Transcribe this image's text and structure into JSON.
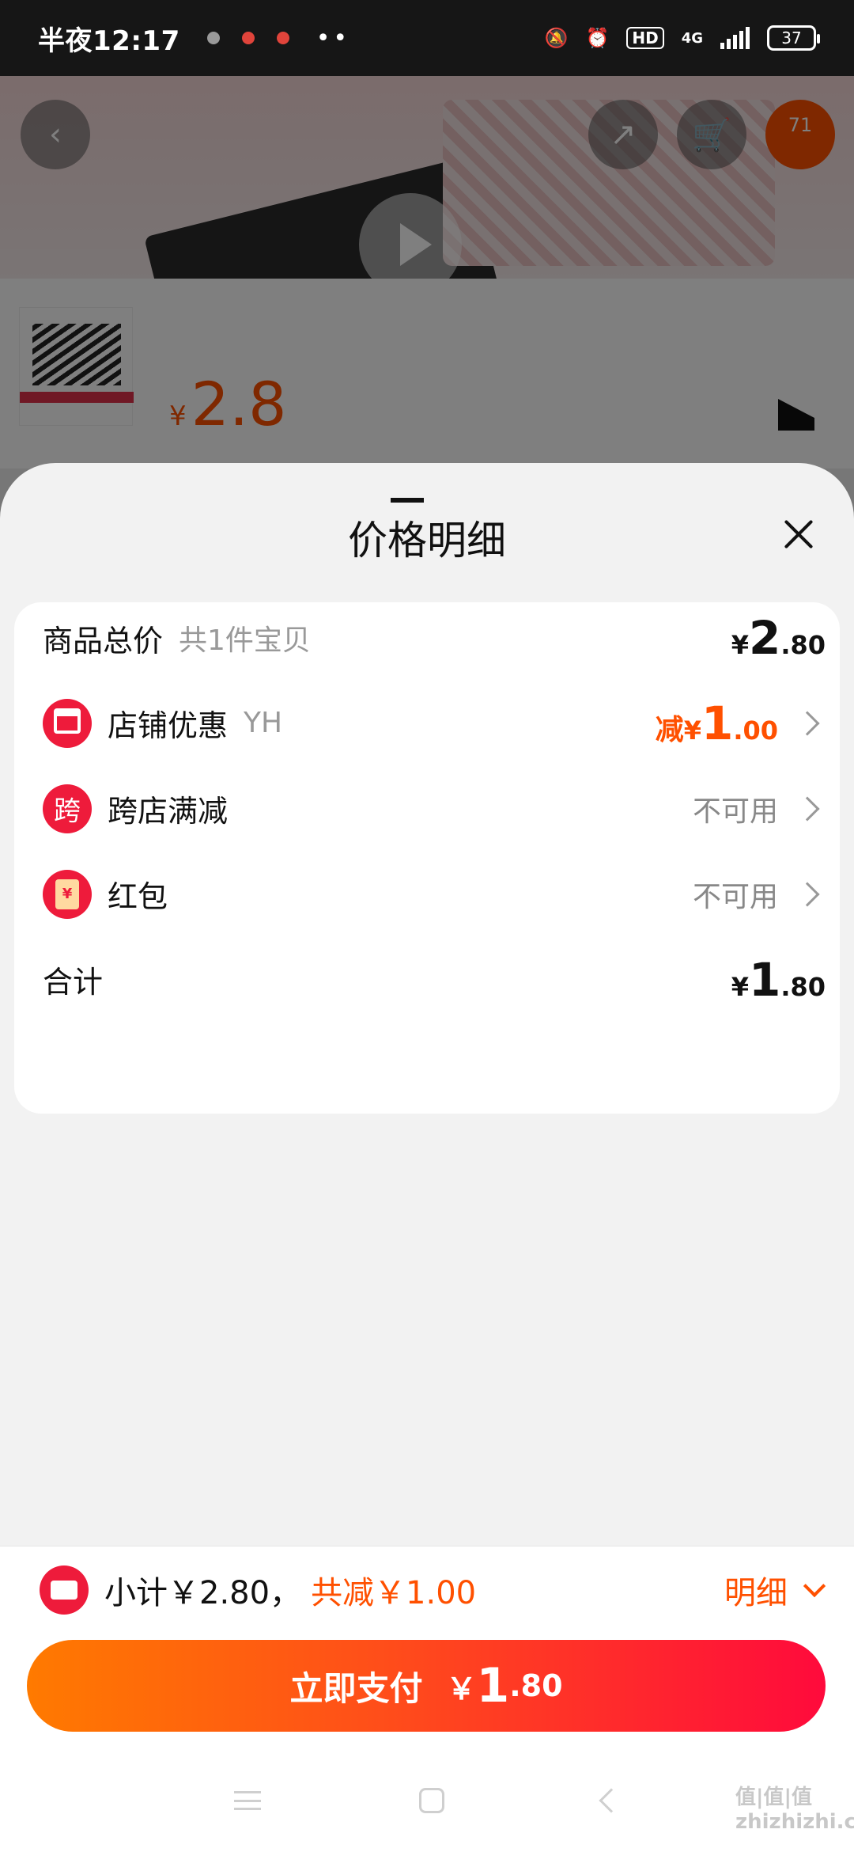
{
  "status_bar": {
    "time": "半夜12:17",
    "network": "4G",
    "hd": "HD",
    "battery": "37",
    "dots": "••"
  },
  "background_page": {
    "cart_count": "71",
    "sku_currency": "¥",
    "sku_price": "2.8"
  },
  "sheet": {
    "title": "价格明细",
    "rows": [
      {
        "label": "商品总价",
        "sub": "共1件宝贝",
        "currency": "¥",
        "int": "2",
        "dec": ".80"
      },
      {
        "label": "店铺优惠",
        "sub": "YH",
        "prefix": "减",
        "currency": "¥",
        "int": "1",
        "dec": ".00"
      },
      {
        "label": "跨店满减",
        "icon_text": "跨",
        "status": "不可用"
      },
      {
        "label": "红包",
        "icon_text": "¥",
        "status": "不可用"
      },
      {
        "label": "合计",
        "currency": "¥",
        "int": "1",
        "dec": ".80"
      }
    ]
  },
  "bottom_bar": {
    "subtotal": "小计￥2.80，",
    "discount": "共减￥1.00",
    "detail": "明细",
    "pay_label": "立即支付",
    "pay_currency": "￥",
    "pay_int": "1",
    "pay_dec": ".80"
  },
  "watermark": "值|值|值 zhizhizhi.com",
  "colors": {
    "accent": "#ff5000",
    "brand_red": "#ee1b3b"
  }
}
